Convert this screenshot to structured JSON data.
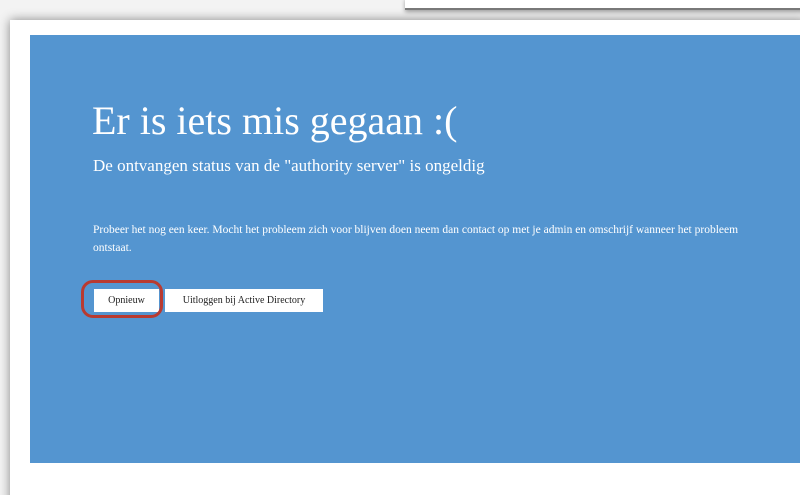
{
  "error": {
    "title": "Er is iets mis gegaan :(",
    "subtitle": "De ontvangen status van de \"authority server\" is ongeldig",
    "message": "Probeer het nog een keer. Mocht het probleem zich voor blijven doen neem dan contact op met je admin en omschrijf wanneer het probleem ontstaat."
  },
  "actions": {
    "retry_label": "Opnieuw",
    "logout_label": "Uitloggen bij Active Directory"
  },
  "colors": {
    "panel_background": "#5495d0",
    "text": "#ffffff",
    "highlight_ring": "#b93a30"
  }
}
